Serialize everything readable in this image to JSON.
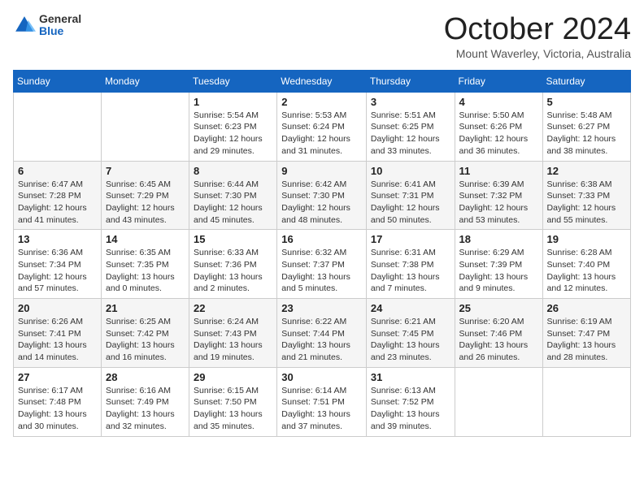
{
  "header": {
    "logo": {
      "general": "General",
      "blue": "Blue"
    },
    "title": "October 2024",
    "location": "Mount Waverley, Victoria, Australia"
  },
  "days_of_week": [
    "Sunday",
    "Monday",
    "Tuesday",
    "Wednesday",
    "Thursday",
    "Friday",
    "Saturday"
  ],
  "weeks": [
    [
      null,
      null,
      {
        "day": 1,
        "sunrise": "5:54 AM",
        "sunset": "6:23 PM",
        "daylight": "12 hours and 29 minutes."
      },
      {
        "day": 2,
        "sunrise": "5:53 AM",
        "sunset": "6:24 PM",
        "daylight": "12 hours and 31 minutes."
      },
      {
        "day": 3,
        "sunrise": "5:51 AM",
        "sunset": "6:25 PM",
        "daylight": "12 hours and 33 minutes."
      },
      {
        "day": 4,
        "sunrise": "5:50 AM",
        "sunset": "6:26 PM",
        "daylight": "12 hours and 36 minutes."
      },
      {
        "day": 5,
        "sunrise": "5:48 AM",
        "sunset": "6:27 PM",
        "daylight": "12 hours and 38 minutes."
      }
    ],
    [
      {
        "day": 6,
        "sunrise": "6:47 AM",
        "sunset": "7:28 PM",
        "daylight": "12 hours and 41 minutes."
      },
      {
        "day": 7,
        "sunrise": "6:45 AM",
        "sunset": "7:29 PM",
        "daylight": "12 hours and 43 minutes."
      },
      {
        "day": 8,
        "sunrise": "6:44 AM",
        "sunset": "7:30 PM",
        "daylight": "12 hours and 45 minutes."
      },
      {
        "day": 9,
        "sunrise": "6:42 AM",
        "sunset": "7:30 PM",
        "daylight": "12 hours and 48 minutes."
      },
      {
        "day": 10,
        "sunrise": "6:41 AM",
        "sunset": "7:31 PM",
        "daylight": "12 hours and 50 minutes."
      },
      {
        "day": 11,
        "sunrise": "6:39 AM",
        "sunset": "7:32 PM",
        "daylight": "12 hours and 53 minutes."
      },
      {
        "day": 12,
        "sunrise": "6:38 AM",
        "sunset": "7:33 PM",
        "daylight": "12 hours and 55 minutes."
      }
    ],
    [
      {
        "day": 13,
        "sunrise": "6:36 AM",
        "sunset": "7:34 PM",
        "daylight": "12 hours and 57 minutes."
      },
      {
        "day": 14,
        "sunrise": "6:35 AM",
        "sunset": "7:35 PM",
        "daylight": "13 hours and 0 minutes."
      },
      {
        "day": 15,
        "sunrise": "6:33 AM",
        "sunset": "7:36 PM",
        "daylight": "13 hours and 2 minutes."
      },
      {
        "day": 16,
        "sunrise": "6:32 AM",
        "sunset": "7:37 PM",
        "daylight": "13 hours and 5 minutes."
      },
      {
        "day": 17,
        "sunrise": "6:31 AM",
        "sunset": "7:38 PM",
        "daylight": "13 hours and 7 minutes."
      },
      {
        "day": 18,
        "sunrise": "6:29 AM",
        "sunset": "7:39 PM",
        "daylight": "13 hours and 9 minutes."
      },
      {
        "day": 19,
        "sunrise": "6:28 AM",
        "sunset": "7:40 PM",
        "daylight": "13 hours and 12 minutes."
      }
    ],
    [
      {
        "day": 20,
        "sunrise": "6:26 AM",
        "sunset": "7:41 PM",
        "daylight": "13 hours and 14 minutes."
      },
      {
        "day": 21,
        "sunrise": "6:25 AM",
        "sunset": "7:42 PM",
        "daylight": "13 hours and 16 minutes."
      },
      {
        "day": 22,
        "sunrise": "6:24 AM",
        "sunset": "7:43 PM",
        "daylight": "13 hours and 19 minutes."
      },
      {
        "day": 23,
        "sunrise": "6:22 AM",
        "sunset": "7:44 PM",
        "daylight": "13 hours and 21 minutes."
      },
      {
        "day": 24,
        "sunrise": "6:21 AM",
        "sunset": "7:45 PM",
        "daylight": "13 hours and 23 minutes."
      },
      {
        "day": 25,
        "sunrise": "6:20 AM",
        "sunset": "7:46 PM",
        "daylight": "13 hours and 26 minutes."
      },
      {
        "day": 26,
        "sunrise": "6:19 AM",
        "sunset": "7:47 PM",
        "daylight": "13 hours and 28 minutes."
      }
    ],
    [
      {
        "day": 27,
        "sunrise": "6:17 AM",
        "sunset": "7:48 PM",
        "daylight": "13 hours and 30 minutes."
      },
      {
        "day": 28,
        "sunrise": "6:16 AM",
        "sunset": "7:49 PM",
        "daylight": "13 hours and 32 minutes."
      },
      {
        "day": 29,
        "sunrise": "6:15 AM",
        "sunset": "7:50 PM",
        "daylight": "13 hours and 35 minutes."
      },
      {
        "day": 30,
        "sunrise": "6:14 AM",
        "sunset": "7:51 PM",
        "daylight": "13 hours and 37 minutes."
      },
      {
        "day": 31,
        "sunrise": "6:13 AM",
        "sunset": "7:52 PM",
        "daylight": "13 hours and 39 minutes."
      },
      null,
      null
    ]
  ]
}
